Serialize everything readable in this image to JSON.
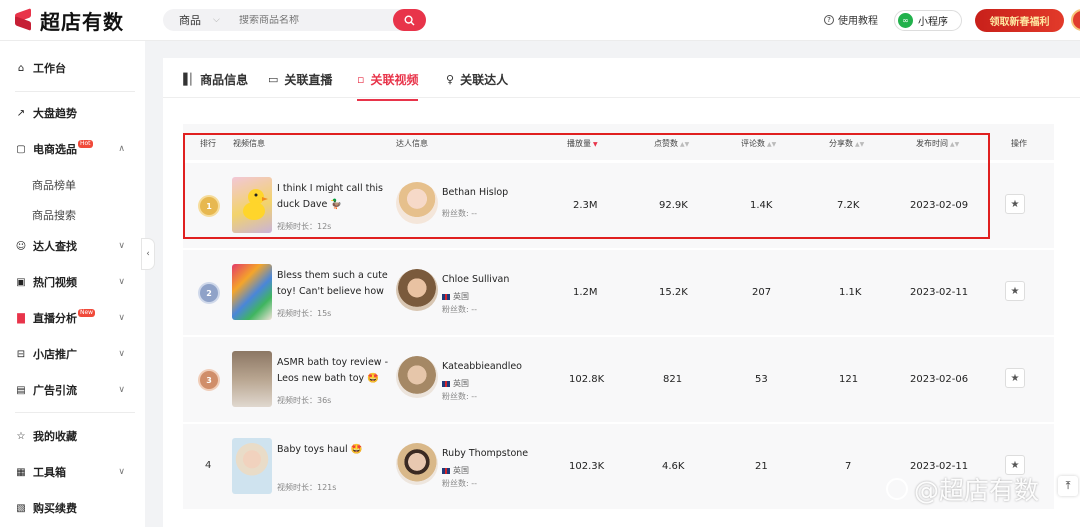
{
  "app": {
    "logo_text": "超店有数"
  },
  "search": {
    "type_label": "商品",
    "placeholder": "搜索商品名称"
  },
  "header": {
    "tutorial_label": "使用教程",
    "miniapp_label": "小程序",
    "promo_label": "领取新春福利"
  },
  "sidebar": {
    "items": [
      {
        "label": "工作台",
        "icon": "home-icon"
      },
      {
        "label": "大盘趋势",
        "icon": "trend-icon"
      },
      {
        "label": "电商选品",
        "icon": "bag-icon",
        "badge": "Hot"
      },
      {
        "label": "商品榜单"
      },
      {
        "label": "商品搜索"
      },
      {
        "label": "达人查找",
        "icon": "people-icon"
      },
      {
        "label": "热门视频",
        "icon": "video-icon"
      },
      {
        "label": "直播分析",
        "icon": "bar-icon",
        "badge": "New"
      },
      {
        "label": "小店推广",
        "icon": "store-icon"
      },
      {
        "label": "广告引流",
        "icon": "ad-icon"
      },
      {
        "label": "我的收藏",
        "icon": "star-icon"
      },
      {
        "label": "工具箱",
        "icon": "toolbox-icon"
      },
      {
        "label": "购买续费",
        "icon": "cart-icon"
      }
    ]
  },
  "tabs": [
    {
      "label": "商品信息",
      "icon": "bar-chart-icon"
    },
    {
      "label": "关联直播",
      "icon": "live-icon"
    },
    {
      "label": "关联视频",
      "icon": "video-tab-icon",
      "active": true
    },
    {
      "label": "关联达人",
      "icon": "user-icon"
    }
  ],
  "table": {
    "headers": {
      "rank": "排行",
      "video": "视频信息",
      "creator": "达人信息",
      "plays": "播放量",
      "likes": "点赞数",
      "comments": "评论数",
      "shares": "分享数",
      "date": "发布时间",
      "action": "操作"
    },
    "duration_prefix": "视频时长：",
    "fans_label": "粉丝数: --",
    "rows": [
      {
        "rank": "1",
        "title": "I think I might call this duck Dave 🦆 #tiktokmade",
        "duration": "12s",
        "creator": "Bethan Hislop",
        "country": "",
        "plays": "2.3M",
        "likes": "92.9K",
        "comments": "1.4K",
        "shares": "7.2K",
        "date": "2023-02-09"
      },
      {
        "rank": "2",
        "title": "Bless them such a cute toy! Can't believe how o...",
        "duration": "15s",
        "creator": "Chloe Sullivan",
        "country": "英国",
        "plays": "1.2M",
        "likes": "15.2K",
        "comments": "207",
        "shares": "1.1K",
        "date": "2023-02-11"
      },
      {
        "rank": "3",
        "title": "ASMR bath toy review - Leos new bath toy 🤩 ca...",
        "duration": "36s",
        "creator": "Kateabbieandleo",
        "country": "英国",
        "plays": "102.8K",
        "likes": "821",
        "comments": "53",
        "shares": "121",
        "date": "2023-02-06"
      },
      {
        "rank": "4",
        "title": "Baby toys haul 🤩",
        "duration": "121s",
        "creator": "Ruby Thompstone",
        "country": "英国",
        "plays": "102.3K",
        "likes": "4.6K",
        "comments": "21",
        "shares": "7",
        "date": "2023-02-11"
      }
    ]
  },
  "watermark": "@超店有数",
  "colors": {
    "accent": "#e8344a",
    "highlight": "#e02020"
  }
}
